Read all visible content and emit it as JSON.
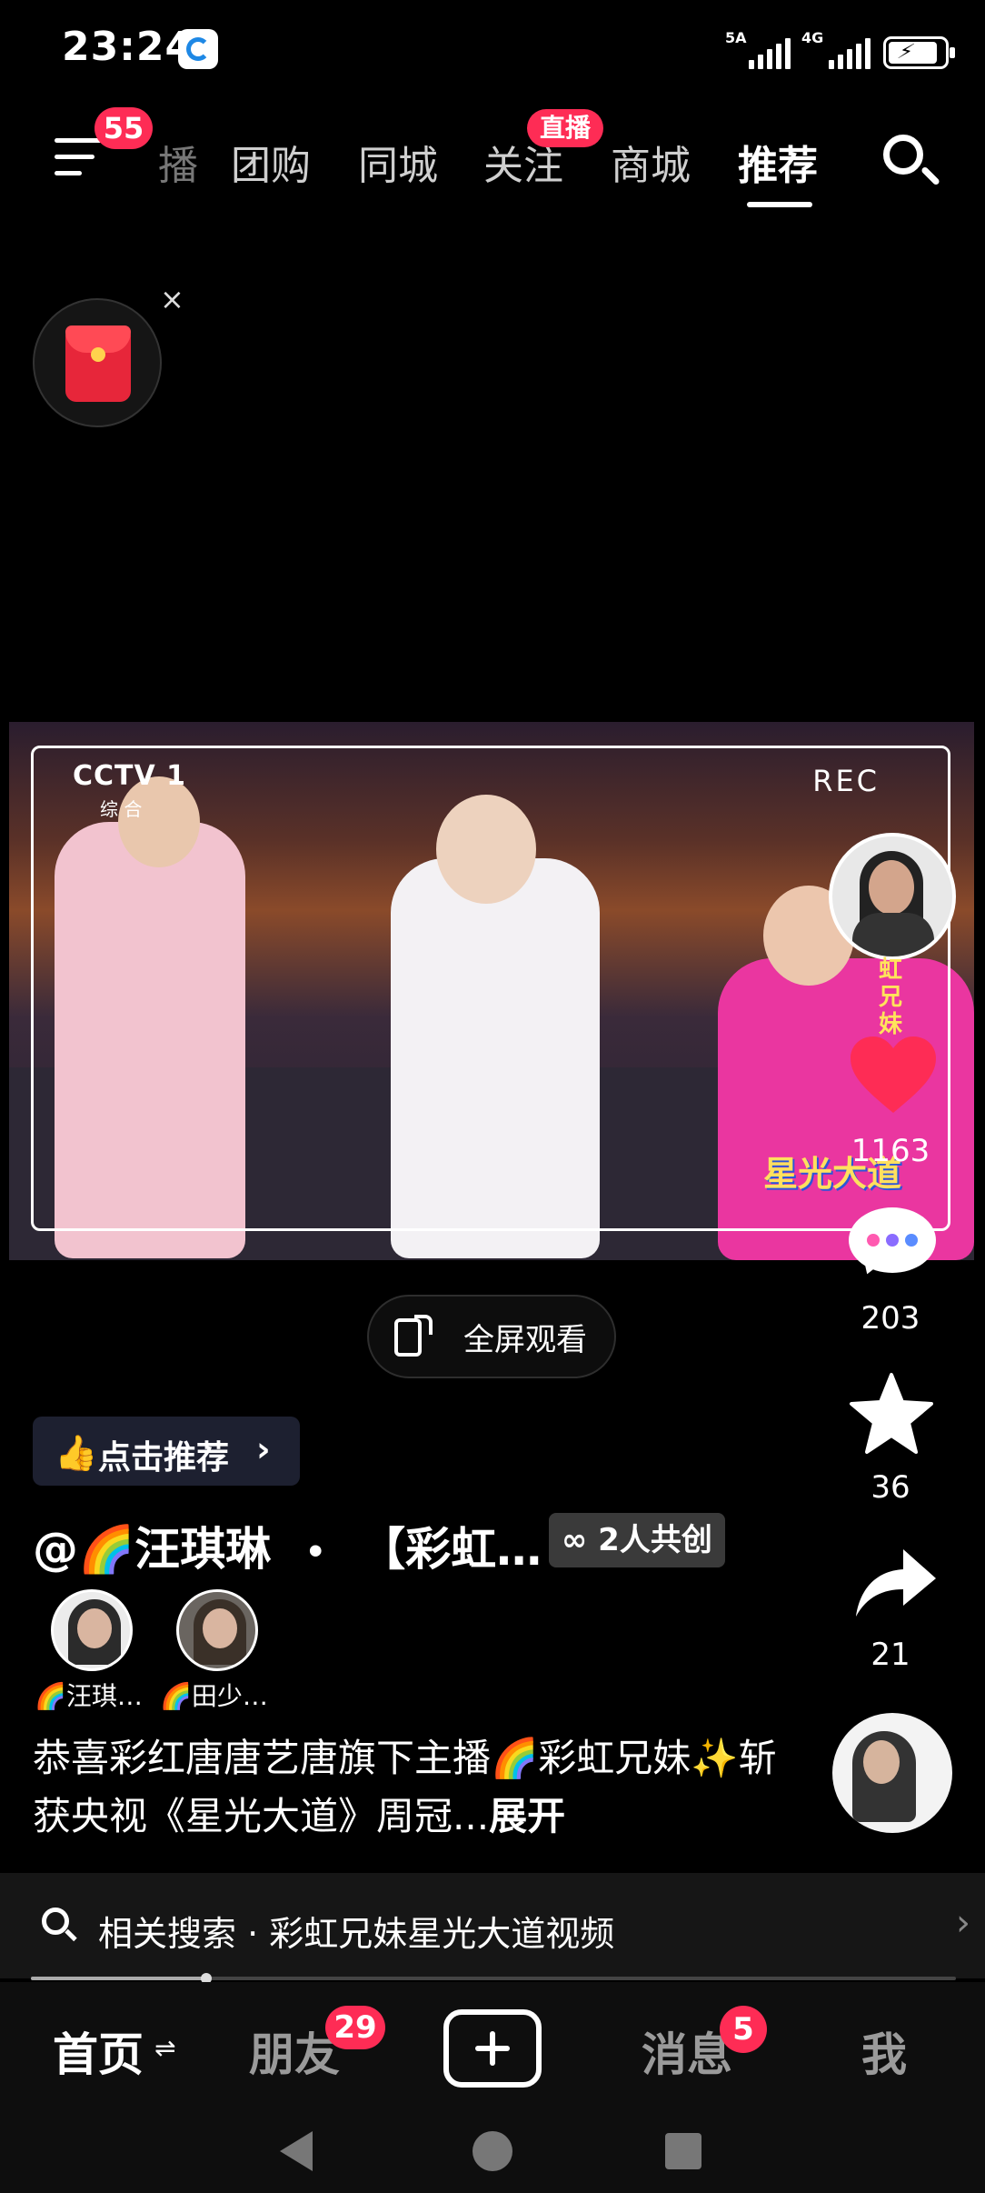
{
  "status_bar": {
    "time": "23:24",
    "network_1_label": "5A",
    "network_2_label": "4G",
    "battery_level": 0.9
  },
  "top_nav": {
    "menu_badge": "55",
    "tabs": [
      {
        "label": "播",
        "state": "partial"
      },
      {
        "label": "团购"
      },
      {
        "label": "同城"
      },
      {
        "label": "关注"
      },
      {
        "label": "商城"
      },
      {
        "label": "推荐",
        "state": "selected"
      }
    ],
    "live_badge": "直播",
    "search_icon": "search-icon"
  },
  "red_packet": {
    "close_label": "×",
    "icon": "red-envelope-icon"
  },
  "video": {
    "channel_logo": "CCTV 1",
    "channel_sub": "综 合",
    "rec_label": "REC",
    "show_logo": "星光大道"
  },
  "right_rail": {
    "creator_name_vertical": "虹兄妹",
    "like_count": "1163",
    "comment_count": "203",
    "favorite_count": "36",
    "share_count": "21",
    "colors": {
      "like": "#fe2c55",
      "comment_dots": [
        "#ff5ab0",
        "#8a6cff",
        "#5a8cff"
      ]
    }
  },
  "fullscreen": {
    "label": "全屏观看"
  },
  "recommend": {
    "label": "点击推荐",
    "chevron": "›"
  },
  "post": {
    "author": "@🌈汪琪琳",
    "separator": "•",
    "title_truncated": "【彩虹…",
    "cocreate_label": "2人共创",
    "co_creators": [
      {
        "name": "🌈汪琪…"
      },
      {
        "name": "🌈田少…"
      }
    ],
    "description": "恭喜彩红唐唐艺唐旗下主播🌈彩虹兄妹✨斩获央视《星光大道》周冠...",
    "expand_label": "展开"
  },
  "related_search": {
    "text": "相关搜索 · 彩虹兄妹星光大道视频",
    "chevron": "›"
  },
  "playback": {
    "progress": 0.19
  },
  "bottom_nav": {
    "home": "首页",
    "home_icon": "⇌",
    "friends": "朋友",
    "friends_badge": "29",
    "add_icon": "plus-icon",
    "messages": "消息",
    "messages_badge": "5",
    "me": "我"
  }
}
